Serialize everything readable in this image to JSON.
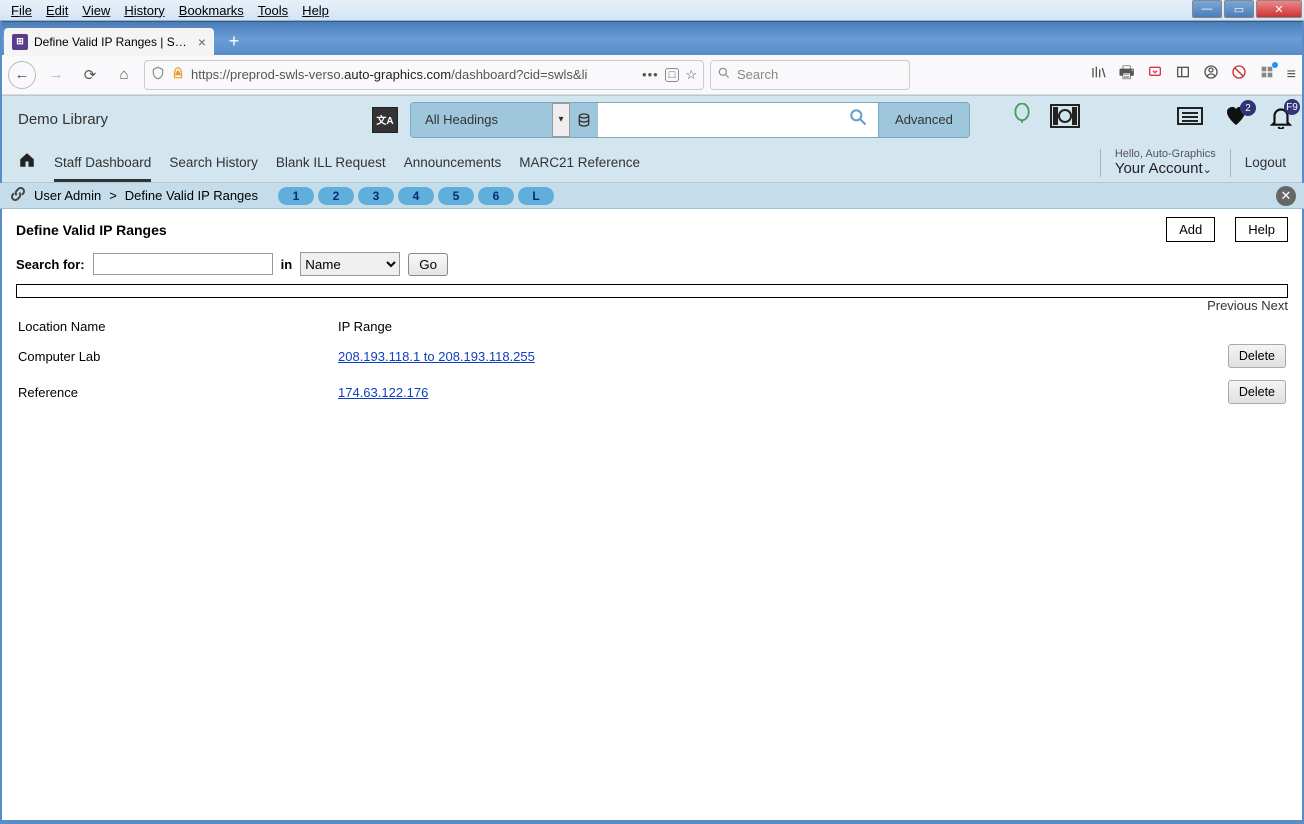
{
  "browser": {
    "menus": [
      "File",
      "Edit",
      "View",
      "History",
      "Bookmarks",
      "Tools",
      "Help"
    ],
    "tab_title": "Define Valid IP Ranges | SWLS |",
    "url_display_prefix": "https://preprod-swls-verso.",
    "url_display_host": "auto-graphics.com",
    "url_display_path": "/dashboard?cid=swls&li",
    "search_placeholder": "Search"
  },
  "app": {
    "library_name": "Demo Library",
    "search_scope": "All Headings",
    "advanced_label": "Advanced",
    "heart_badge": "2",
    "bell_badge": "F9",
    "nav": {
      "home_icon": "home",
      "items": [
        "Staff Dashboard",
        "Search History",
        "Blank ILL Request",
        "Announcements",
        "MARC21 Reference"
      ],
      "hello": "Hello, Auto-Graphics",
      "account": "Your Account",
      "logout": "Logout"
    },
    "crumb": {
      "section": "User Admin",
      "page": "Define Valid IP Ranges",
      "pills": [
        "1",
        "2",
        "3",
        "4",
        "5",
        "6",
        "L"
      ]
    }
  },
  "page": {
    "title": "Define Valid IP Ranges",
    "add_label": "Add",
    "help_label": "Help",
    "search_label": "Search for:",
    "in_label": "in",
    "in_field": "Name",
    "go_label": "Go",
    "prev_label": "Previous",
    "next_label": "Next",
    "columns": {
      "location": "Location Name",
      "range": "IP Range"
    },
    "rows": [
      {
        "location": "Computer Lab",
        "range": "208.193.118.1 to 208.193.118.255"
      },
      {
        "location": "Reference",
        "range": "174.63.122.176"
      }
    ],
    "delete_label": "Delete"
  }
}
